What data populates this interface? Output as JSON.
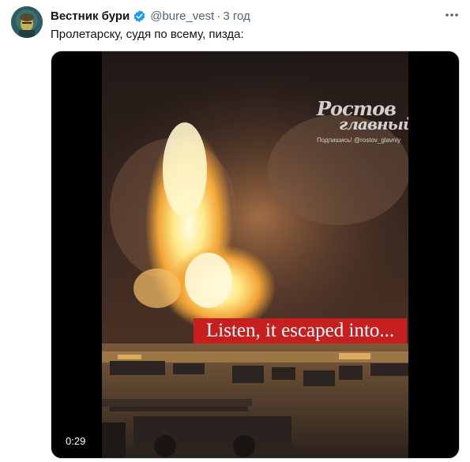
{
  "tweet": {
    "author_name": "Вестник бури",
    "handle": "@bure_vest",
    "separator": "·",
    "time": "3 год",
    "text": "Пролетарску, судя по всему, пизда:"
  },
  "icons": {
    "avatar": "avatar-image",
    "verified": "verified-badge-icon",
    "more": "more-options-icon"
  },
  "colors": {
    "verified": "#1d9bf0",
    "caption_background": "#c51f1f"
  },
  "media": {
    "watermark_logo_text_1": "Ростов",
    "watermark_logo_text_2": "главный",
    "watermark_subtitle": "Подпишись! @rostov_glavniy",
    "caption": "Listen, it escaped into...",
    "video_time": "0:29"
  }
}
